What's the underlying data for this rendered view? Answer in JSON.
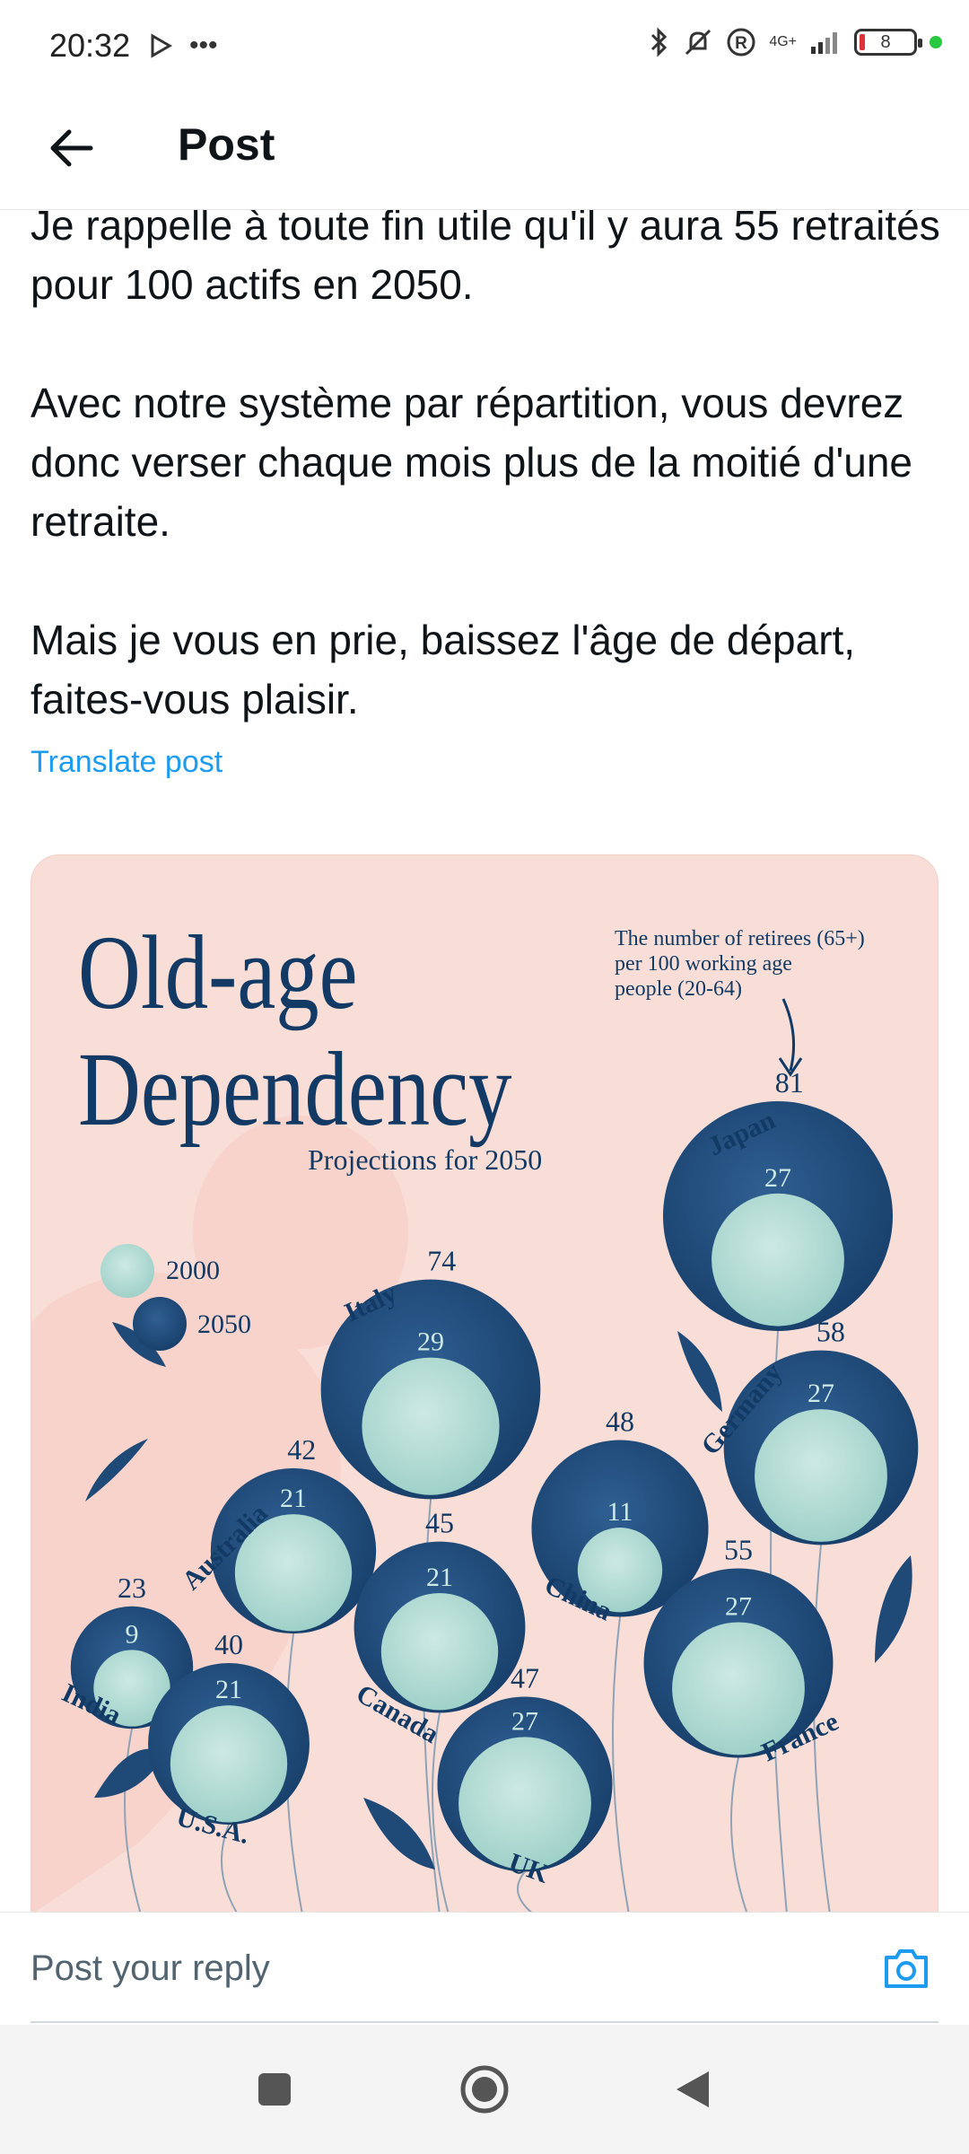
{
  "status_bar": {
    "time": "20:32",
    "network": "4G+",
    "battery": "8"
  },
  "app_bar": {
    "title": "Post"
  },
  "post": {
    "paragraphs": [
      "Je rappelle à toute fin utile qu'il y aura 55 retraités pour 100 actifs en 2050.",
      "Avec notre système par répartition, vous devrez donc verser chaque mois plus de la moitié d'une retraite.",
      "Mais je vous en prie, baissez l'âge de départ, faites-vous plaisir."
    ],
    "translate_label": "Translate post"
  },
  "infographic": {
    "title_line1": "Old-age",
    "title_line2": "Dependency",
    "subtitle": "Projections for 2050",
    "note_line1": "The number of retirees (65+)",
    "note_line2": "per 100 working age",
    "note_line3": "people (20-64)",
    "legend_2000": "2000",
    "legend_2050": "2050",
    "colors": {
      "background": "#f9ded8",
      "circle_2050": "#1f4a78",
      "circle_2000": "#b4ddd6",
      "title": "#123a64"
    }
  },
  "chart_data": {
    "type": "bubble",
    "title": "Old-age Dependency",
    "subtitle": "Projections for 2050",
    "series": [
      {
        "name": "2000",
        "values": [
          27,
          29,
          27,
          11,
          21,
          21,
          27,
          9,
          21,
          27
        ]
      },
      {
        "name": "2050",
        "values": [
          81,
          74,
          58,
          48,
          42,
          45,
          55,
          23,
          40,
          47
        ]
      }
    ],
    "categories": [
      "Japan",
      "Italy",
      "Germany",
      "China",
      "Australia",
      "Canada",
      "France",
      "India",
      "U.S.A.",
      "UK"
    ]
  },
  "reply": {
    "placeholder": "Post your reply"
  }
}
